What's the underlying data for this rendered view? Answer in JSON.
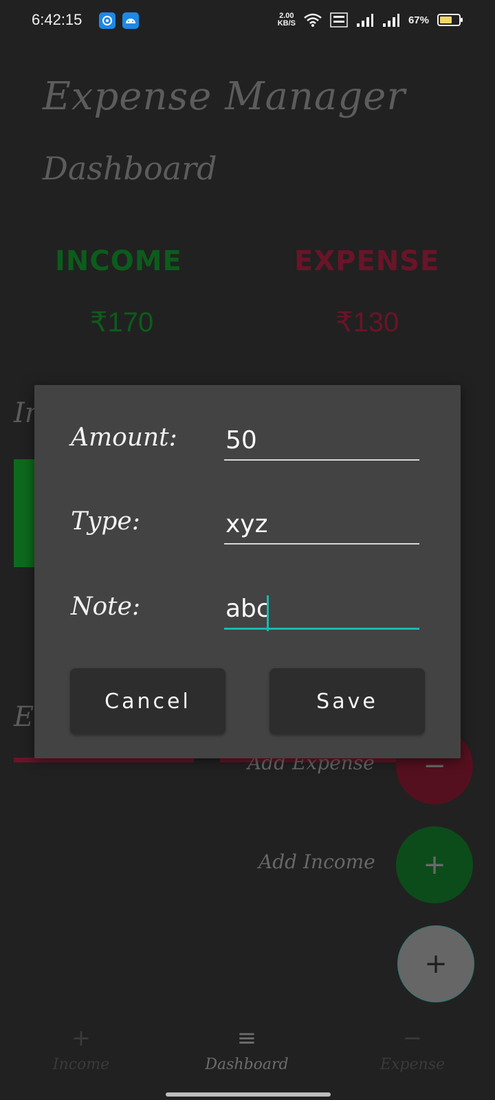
{
  "status_bar": {
    "time": "6:42:15",
    "net_speed_value": "2.00",
    "net_speed_unit": "KB/S",
    "battery_percent": "67%",
    "battery_level": 0.67
  },
  "app": {
    "title": "Expense Manager",
    "screen_title": "Dashboard"
  },
  "summary": {
    "income_label": "INCOME",
    "income_value": "₹170",
    "expense_label": "EXPENSE",
    "expense_value": "₹130",
    "income_color": "#0c5c1c",
    "expense_color": "#6a1428"
  },
  "background_sections": {
    "income_heading_partial": "In",
    "expense_heading_partial": "E"
  },
  "fab": {
    "add_expense_label": "Add Expense",
    "add_income_label": "Add Income",
    "expense_icon": "−",
    "income_icon": "+",
    "main_icon": "+"
  },
  "dialog": {
    "amount_label": "Amount:",
    "amount_value": "50",
    "type_label": "Type:",
    "type_value": "xyz",
    "note_label": "Note:",
    "note_value": "abc",
    "cancel_label": "Cancel",
    "save_label": "Save",
    "accent_color": "#19b9b0"
  },
  "bottom_nav": {
    "items": [
      {
        "label": "Income",
        "icon": "+"
      },
      {
        "label": "Dashboard",
        "icon": "≡"
      },
      {
        "label": "Expense",
        "icon": "−"
      }
    ]
  }
}
